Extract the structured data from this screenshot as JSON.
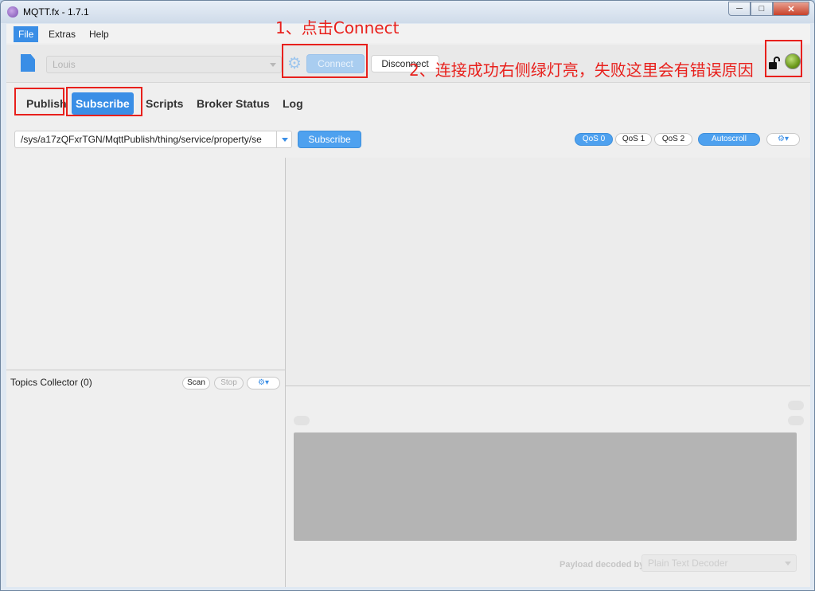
{
  "window": {
    "title": "MQTT.fx - 1.7.1"
  },
  "menu": {
    "items": [
      "File",
      "Extras",
      "Help"
    ]
  },
  "toolbar": {
    "profile": "Louis",
    "connect_label": "Connect",
    "disconnect_label": "Disconnect"
  },
  "tabs": [
    "Publish",
    "Subscribe",
    "Scripts",
    "Broker Status",
    "Log"
  ],
  "subscribe_bar": {
    "topic": "/sys/a17zQFxrTGN/MqttPublish/thing/service/property/se",
    "subscribe_label": "Subscribe",
    "qos": [
      "QoS 0",
      "QoS 1",
      "QoS 2"
    ],
    "autoscroll_label": "Autoscroll"
  },
  "topics_collector": {
    "title": "Topics Collector (0)",
    "scan_label": "Scan",
    "stop_label": "Stop"
  },
  "detail": {
    "payload_label": "Payload decoded by",
    "decoder": "Plain Text Decoder"
  },
  "annotations": {
    "step1": "1、点击Connect",
    "step2": "2、连接成功右侧绿灯亮，失败这里会有错误原因"
  },
  "colors": {
    "accent": "#3a8ee6",
    "annotation": "#e8201c",
    "status_led": "#6c9a1c"
  }
}
